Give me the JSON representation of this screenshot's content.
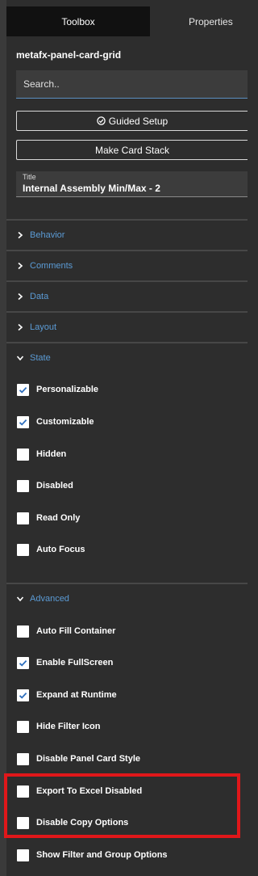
{
  "tabs": {
    "toolbox": "Toolbox",
    "properties": "Properties"
  },
  "component_name": "metafx-panel-card-grid",
  "search": {
    "placeholder": "Search..",
    "value": ""
  },
  "buttons": {
    "guided_setup": "Guided Setup",
    "make_card_stack": "Make Card Stack"
  },
  "title_field": {
    "label": "Title",
    "value": "Internal Assembly Min/Max - 2"
  },
  "sections": {
    "behavior": "Behavior",
    "comments": "Comments",
    "data": "Data",
    "layout": "Layout",
    "state": "State",
    "advanced": "Advanced"
  },
  "state_options": [
    {
      "label": "Personalizable",
      "checked": true
    },
    {
      "label": "Customizable",
      "checked": true
    },
    {
      "label": "Hidden",
      "checked": false
    },
    {
      "label": "Disabled",
      "checked": false
    },
    {
      "label": "Read Only",
      "checked": false
    },
    {
      "label": "Auto Focus",
      "checked": false
    }
  ],
  "advanced_options": [
    {
      "label": "Auto Fill Container",
      "checked": false
    },
    {
      "label": "Enable FullScreen",
      "checked": true
    },
    {
      "label": "Expand at Runtime",
      "checked": true
    },
    {
      "label": "Hide Filter Icon",
      "checked": false
    },
    {
      "label": "Disable Panel Card Style",
      "checked": false
    },
    {
      "label": "Export To Excel Disabled",
      "checked": false
    },
    {
      "label": "Disable Copy Options",
      "checked": false
    },
    {
      "label": "Show Filter and Group Options",
      "checked": false
    }
  ],
  "colors": {
    "accent": "#5b9bd5",
    "checkbox_check": "#2f6fbd",
    "highlight": "#e0171a",
    "background": "#2d2d2d"
  }
}
